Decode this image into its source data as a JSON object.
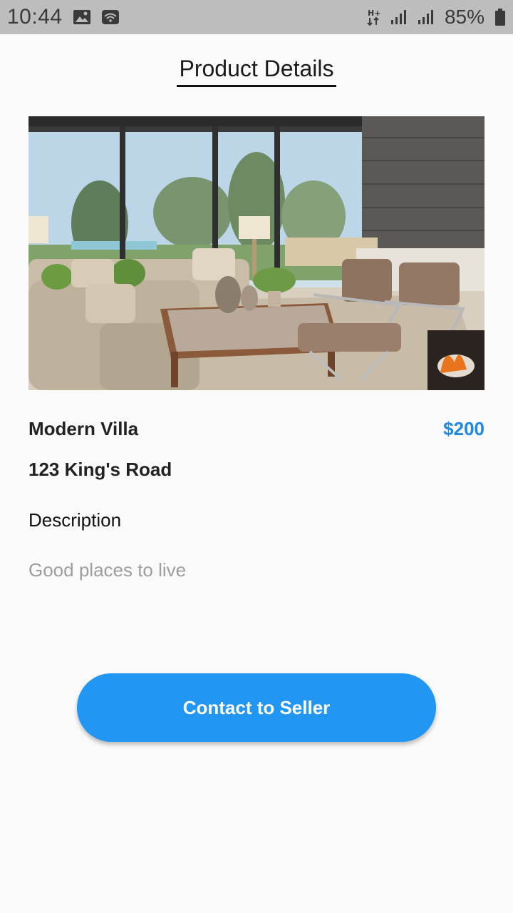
{
  "status_bar": {
    "time": "10:44",
    "battery": "85%",
    "icons": [
      "image-icon",
      "wifi-icon",
      "data-arrows-icon",
      "signal-icon",
      "signal-icon",
      "battery-icon"
    ]
  },
  "header": {
    "title": "Product Details"
  },
  "product": {
    "image_name": "living-room-photo",
    "name": "Modern Villa",
    "price": "$200",
    "address": "123 King's Road"
  },
  "description": {
    "heading": "Description",
    "text": "Good places to live"
  },
  "actions": {
    "contact_label": "Contact to Seller"
  },
  "colors": {
    "accent": "#2196f3",
    "price": "#1e88e5",
    "status_bar": "#bdbdbd",
    "description_text": "#9e9e9e"
  }
}
